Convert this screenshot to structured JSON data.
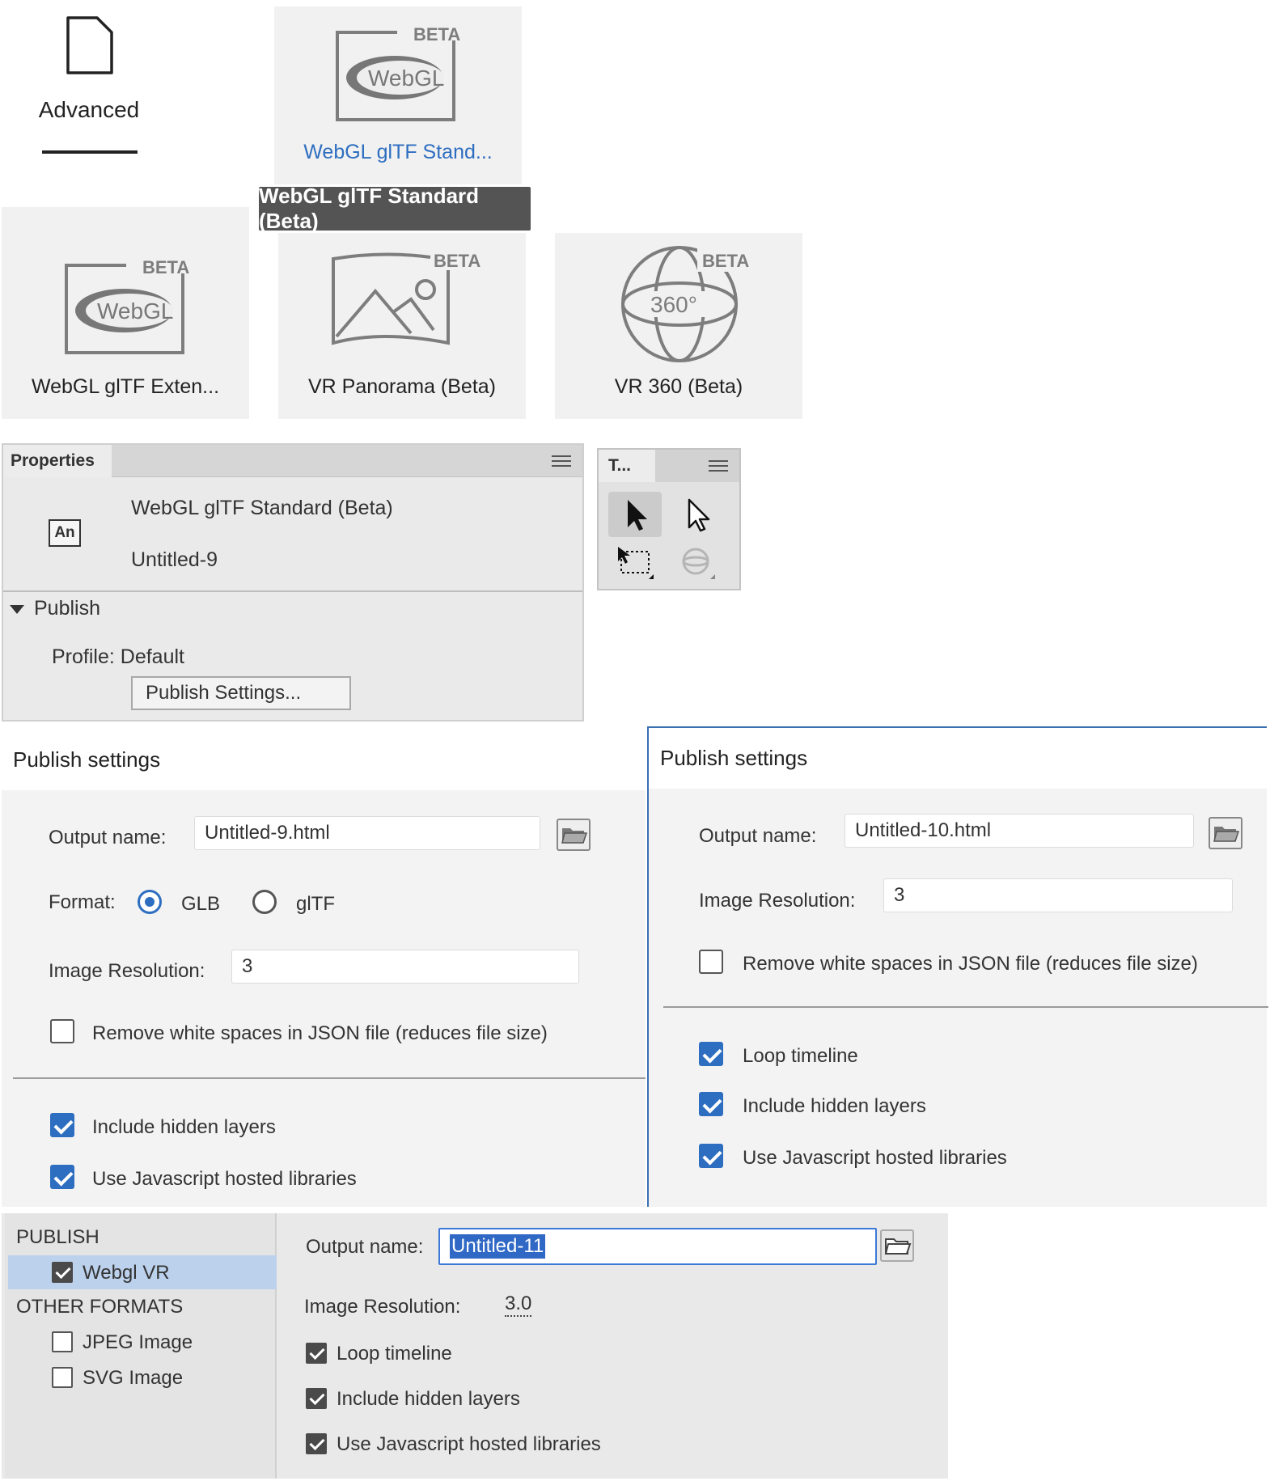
{
  "templates": {
    "advanced_tab": {
      "label": "Advanced",
      "icon": "document-icon"
    },
    "tiles": [
      {
        "label": "WebGL glTF Stand...",
        "badge": "BETA",
        "logo_text": "WebGL",
        "icon": "webgl-logo-icon",
        "selected": true
      },
      {
        "label": "WebGL glTF Exten...",
        "badge": "BETA",
        "logo_text": "WebGL",
        "icon": "webgl-logo-icon"
      },
      {
        "label": "VR Panorama (Beta)",
        "badge": "BETA",
        "icon": "panorama-icon"
      },
      {
        "label": "VR 360 (Beta)",
        "badge": "BETA",
        "globe_text": "360°",
        "icon": "globe-360-icon"
      }
    ],
    "tooltip": "WebGL glTF Standard (Beta)",
    "accent_color": "#2e6ec0"
  },
  "properties": {
    "tab": "Properties",
    "app_icon_text": "An",
    "doc_type": "WebGL glTF Standard (Beta)",
    "doc_name": "Untitled-9",
    "section": "Publish",
    "profile_label": "Profile:",
    "profile_value": "Default",
    "publish_settings_button": "Publish Settings..."
  },
  "tools": {
    "tab": "T...",
    "items": [
      "selection-tool-icon",
      "subselection-tool-icon",
      "free-transform-tool-icon",
      "3d-rotation-tool-icon"
    ]
  },
  "publish_left": {
    "title": "Publish settings",
    "output_label": "Output name:",
    "output_value": "Untitled-9.html",
    "format_label": "Format:",
    "format_options": [
      "GLB",
      "glTF"
    ],
    "format_selected": "GLB",
    "resolution_label": "Image Resolution:",
    "resolution_value": "3",
    "remove_ws": "Remove white spaces in JSON file (reduces file size)",
    "include_hidden": "Include hidden layers",
    "use_js": "Use Javascript hosted libraries"
  },
  "publish_right": {
    "title": "Publish settings",
    "output_label": "Output name:",
    "output_value": "Untitled-10.html",
    "resolution_label": "Image Resolution:",
    "resolution_value": "3",
    "remove_ws": "Remove white spaces in JSON file (reduces file size)",
    "loop": "Loop timeline",
    "include_hidden": "Include hidden layers",
    "use_js": "Use Javascript hosted libraries"
  },
  "publish_vr": {
    "publish_header": "PUBLISH",
    "publish_item": "Webgl VR",
    "other_header": "OTHER FORMATS",
    "other_items": [
      "JPEG Image",
      "SVG Image"
    ],
    "output_label": "Output name:",
    "output_value": "Untitled-11",
    "resolution_label": "Image Resolution:",
    "resolution_value": "3.0",
    "loop": "Loop timeline",
    "include_hidden": "Include hidden layers",
    "use_js": "Use Javascript hosted libraries"
  }
}
